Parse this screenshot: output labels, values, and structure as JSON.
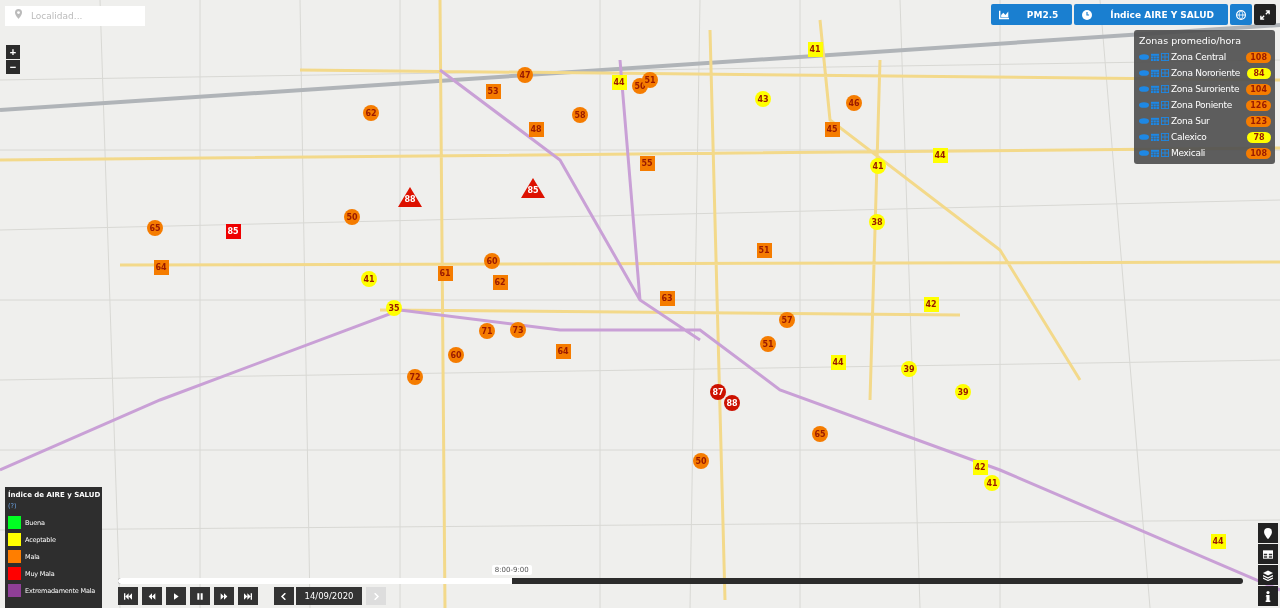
{
  "search": {
    "placeholder": "Localidad..."
  },
  "zoom_controls": [
    "+",
    "−"
  ],
  "top_buttons": [
    {
      "kind": "chart",
      "label": "PM2.5"
    },
    {
      "kind": "clock",
      "label": "Índice AIRE Y SALUD"
    },
    {
      "kind": "globe"
    },
    {
      "kind": "expand"
    }
  ],
  "zones_panel": {
    "title": "Zonas promedio/hora",
    "zones": [
      {
        "name": "Zona Central",
        "value": "108",
        "color": "#f57c00"
      },
      {
        "name": "Zona Nororiente",
        "value": "84",
        "color": "#ffff00"
      },
      {
        "name": "Zona Suroriente",
        "value": "104",
        "color": "#f57c00"
      },
      {
        "name": "Zona Poniente",
        "value": "126",
        "color": "#f57c00"
      },
      {
        "name": "Zona Sur",
        "value": "123",
        "color": "#f57c00"
      },
      {
        "name": "Calexico",
        "value": "78",
        "color": "#ffff00"
      },
      {
        "name": "Mexicali",
        "value": "108",
        "color": "#f57c00"
      }
    ]
  },
  "markers": [
    {
      "kind": "circle",
      "color": "#f57c00",
      "value": "47"
    },
    {
      "kind": "square",
      "color": "#f57c00",
      "value": "53"
    },
    {
      "kind": "circle",
      "color": "#f57c00",
      "value": "62"
    },
    {
      "kind": "circle",
      "color": "#f57c00",
      "value": "58"
    },
    {
      "kind": "square",
      "color": "#f57c00",
      "value": "48"
    },
    {
      "kind": "square",
      "color": "#ffff00",
      "value": "44"
    },
    {
      "kind": "circle",
      "color": "#f57c00",
      "value": "50"
    },
    {
      "kind": "circle",
      "color": "#f57c00",
      "value": "51"
    },
    {
      "kind": "square",
      "color": "#ffff00",
      "value": "41"
    },
    {
      "kind": "circle",
      "color": "#ffff00",
      "value": "43"
    },
    {
      "kind": "circle",
      "color": "#f57c00",
      "value": "46"
    },
    {
      "kind": "square",
      "color": "#f57c00",
      "value": "45"
    },
    {
      "kind": "square",
      "color": "#f57c00",
      "value": "55"
    },
    {
      "kind": "triangle",
      "color": "#dd1100",
      "value": "88"
    },
    {
      "kind": "triangle",
      "color": "#dd1100",
      "value": "85"
    },
    {
      "kind": "circle",
      "color": "#ffff00",
      "value": "41"
    },
    {
      "kind": "square",
      "color": "#ffff00",
      "value": "44"
    },
    {
      "kind": "circle",
      "color": "#f57c00",
      "value": "50"
    },
    {
      "kind": "circle",
      "color": "#f57c00",
      "value": "65"
    },
    {
      "kind": "square",
      "color": "#ee0000",
      "value": "85"
    },
    {
      "kind": "circle",
      "color": "#ffff00",
      "value": "38"
    },
    {
      "kind": "square",
      "color": "#f57c00",
      "value": "51"
    },
    {
      "kind": "circle",
      "color": "#f57c00",
      "value": "60"
    },
    {
      "kind": "square",
      "color": "#f57c00",
      "value": "61"
    },
    {
      "kind": "square",
      "color": "#f57c00",
      "value": "62"
    },
    {
      "kind": "square",
      "color": "#f57c00",
      "value": "64"
    },
    {
      "kind": "circle",
      "color": "#ffff00",
      "value": "41"
    },
    {
      "kind": "square",
      "color": "#f57c00",
      "value": "63"
    },
    {
      "kind": "square",
      "color": "#ffff00",
      "value": "42"
    },
    {
      "kind": "circle",
      "color": "#ffff00",
      "value": "35"
    },
    {
      "kind": "circle",
      "color": "#f57c00",
      "value": "57"
    },
    {
      "kind": "circle",
      "color": "#f57c00",
      "value": "71"
    },
    {
      "kind": "circle",
      "color": "#f57c00",
      "value": "73"
    },
    {
      "kind": "circle",
      "color": "#f57c00",
      "value": "51"
    },
    {
      "kind": "square",
      "color": "#f57c00",
      "value": "64"
    },
    {
      "kind": "circle",
      "color": "#f57c00",
      "value": "60"
    },
    {
      "kind": "square",
      "color": "#ffff00",
      "value": "44"
    },
    {
      "kind": "circle",
      "color": "#ffff00",
      "value": "39"
    },
    {
      "kind": "circle",
      "color": "#f57c00",
      "value": "72"
    },
    {
      "kind": "circle",
      "color": "#cc1100",
      "value": "87"
    },
    {
      "kind": "circle",
      "color": "#cc1100",
      "value": "88"
    },
    {
      "kind": "circle",
      "color": "#ffff00",
      "value": "39"
    },
    {
      "kind": "circle",
      "color": "#f57c00",
      "value": "65"
    },
    {
      "kind": "circle",
      "color": "#f57c00",
      "value": "50"
    },
    {
      "kind": "square",
      "color": "#ffff00",
      "value": "42"
    },
    {
      "kind": "circle",
      "color": "#ffff00",
      "value": "41"
    },
    {
      "kind": "square",
      "color": "#ffff00",
      "value": "44"
    }
  ],
  "legend": {
    "title": "Índice de AIRE y SALUD",
    "help": "(?)",
    "items": [
      {
        "label": "Buena",
        "color": "#00ff22"
      },
      {
        "label": "Aceptable",
        "color": "#ffff00"
      },
      {
        "label": "Mala",
        "color": "#ff7e00"
      },
      {
        "label": "Muy Mala",
        "color": "#ff0000"
      },
      {
        "label": "Extremadamente Mala",
        "color": "#8f3f97"
      }
    ]
  },
  "player": {
    "buttons": [
      {
        "kind": "first"
      },
      {
        "kind": "rewind"
      },
      {
        "kind": "play"
      },
      {
        "kind": "pause"
      },
      {
        "kind": "forward"
      },
      {
        "kind": "last"
      }
    ],
    "time_label": "8:00-9:00",
    "level": 0.35,
    "date": "14/09/2020",
    "next_disabled": true
  },
  "side_tools": [
    {
      "kind": "pin"
    },
    {
      "kind": "table"
    },
    {
      "kind": "layers"
    },
    {
      "kind": "info"
    }
  ]
}
